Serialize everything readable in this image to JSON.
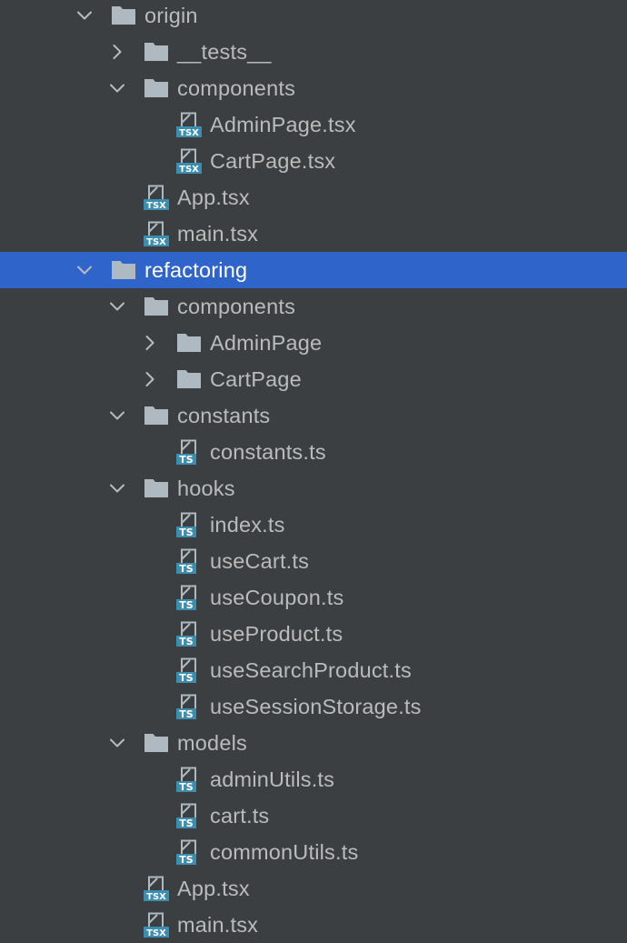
{
  "colors": {
    "background": "#3c3f41",
    "selection": "#2f65ca",
    "text": "#bbbbbb",
    "selected_text": "#ffffff",
    "folder_icon": "#aeb9c2",
    "file_icon": "#aeb9c2",
    "file_badge": "#3d8dae"
  },
  "tree": [
    {
      "label": "origin",
      "depth": 0,
      "kind": "folder",
      "expanded": true,
      "icon": "folder-icon"
    },
    {
      "label": "__tests__",
      "depth": 1,
      "kind": "folder",
      "expanded": false,
      "icon": "folder-icon"
    },
    {
      "label": "components",
      "depth": 1,
      "kind": "folder",
      "expanded": true,
      "icon": "folder-icon"
    },
    {
      "label": "AdminPage.tsx",
      "depth": 2,
      "kind": "file",
      "badge": "TSX",
      "icon": "tsx-file-icon"
    },
    {
      "label": "CartPage.tsx",
      "depth": 2,
      "kind": "file",
      "badge": "TSX",
      "icon": "tsx-file-icon"
    },
    {
      "label": "App.tsx",
      "depth": 1,
      "kind": "file",
      "badge": "TSX",
      "icon": "tsx-file-icon"
    },
    {
      "label": "main.tsx",
      "depth": 1,
      "kind": "file",
      "badge": "TSX",
      "icon": "tsx-file-icon"
    },
    {
      "label": "refactoring",
      "depth": 0,
      "kind": "folder",
      "expanded": true,
      "selected": true,
      "icon": "folder-icon"
    },
    {
      "label": "components",
      "depth": 1,
      "kind": "folder",
      "expanded": true,
      "icon": "folder-icon"
    },
    {
      "label": "AdminPage",
      "depth": 2,
      "kind": "folder",
      "expanded": false,
      "icon": "folder-icon"
    },
    {
      "label": "CartPage",
      "depth": 2,
      "kind": "folder",
      "expanded": false,
      "icon": "folder-icon"
    },
    {
      "label": "constants",
      "depth": 1,
      "kind": "folder",
      "expanded": true,
      "icon": "folder-icon"
    },
    {
      "label": "constants.ts",
      "depth": 2,
      "kind": "file",
      "badge": "TS",
      "icon": "ts-file-icon"
    },
    {
      "label": "hooks",
      "depth": 1,
      "kind": "folder",
      "expanded": true,
      "icon": "folder-icon"
    },
    {
      "label": "index.ts",
      "depth": 2,
      "kind": "file",
      "badge": "TS",
      "icon": "ts-file-icon"
    },
    {
      "label": "useCart.ts",
      "depth": 2,
      "kind": "file",
      "badge": "TS",
      "icon": "ts-file-icon"
    },
    {
      "label": "useCoupon.ts",
      "depth": 2,
      "kind": "file",
      "badge": "TS",
      "icon": "ts-file-icon"
    },
    {
      "label": "useProduct.ts",
      "depth": 2,
      "kind": "file",
      "badge": "TS",
      "icon": "ts-file-icon"
    },
    {
      "label": "useSearchProduct.ts",
      "depth": 2,
      "kind": "file",
      "badge": "TS",
      "icon": "ts-file-icon"
    },
    {
      "label": "useSessionStorage.ts",
      "depth": 2,
      "kind": "file",
      "badge": "TS",
      "icon": "ts-file-icon"
    },
    {
      "label": "models",
      "depth": 1,
      "kind": "folder",
      "expanded": true,
      "icon": "folder-icon"
    },
    {
      "label": "adminUtils.ts",
      "depth": 2,
      "kind": "file",
      "badge": "TS",
      "icon": "ts-file-icon"
    },
    {
      "label": "cart.ts",
      "depth": 2,
      "kind": "file",
      "badge": "TS",
      "icon": "ts-file-icon"
    },
    {
      "label": "commonUtils.ts",
      "depth": 2,
      "kind": "file",
      "badge": "TS",
      "icon": "ts-file-icon"
    },
    {
      "label": "App.tsx",
      "depth": 1,
      "kind": "file",
      "badge": "TSX",
      "icon": "tsx-file-icon"
    },
    {
      "label": "main.tsx",
      "depth": 1,
      "kind": "file",
      "badge": "TSX",
      "icon": "tsx-file-icon"
    }
  ]
}
